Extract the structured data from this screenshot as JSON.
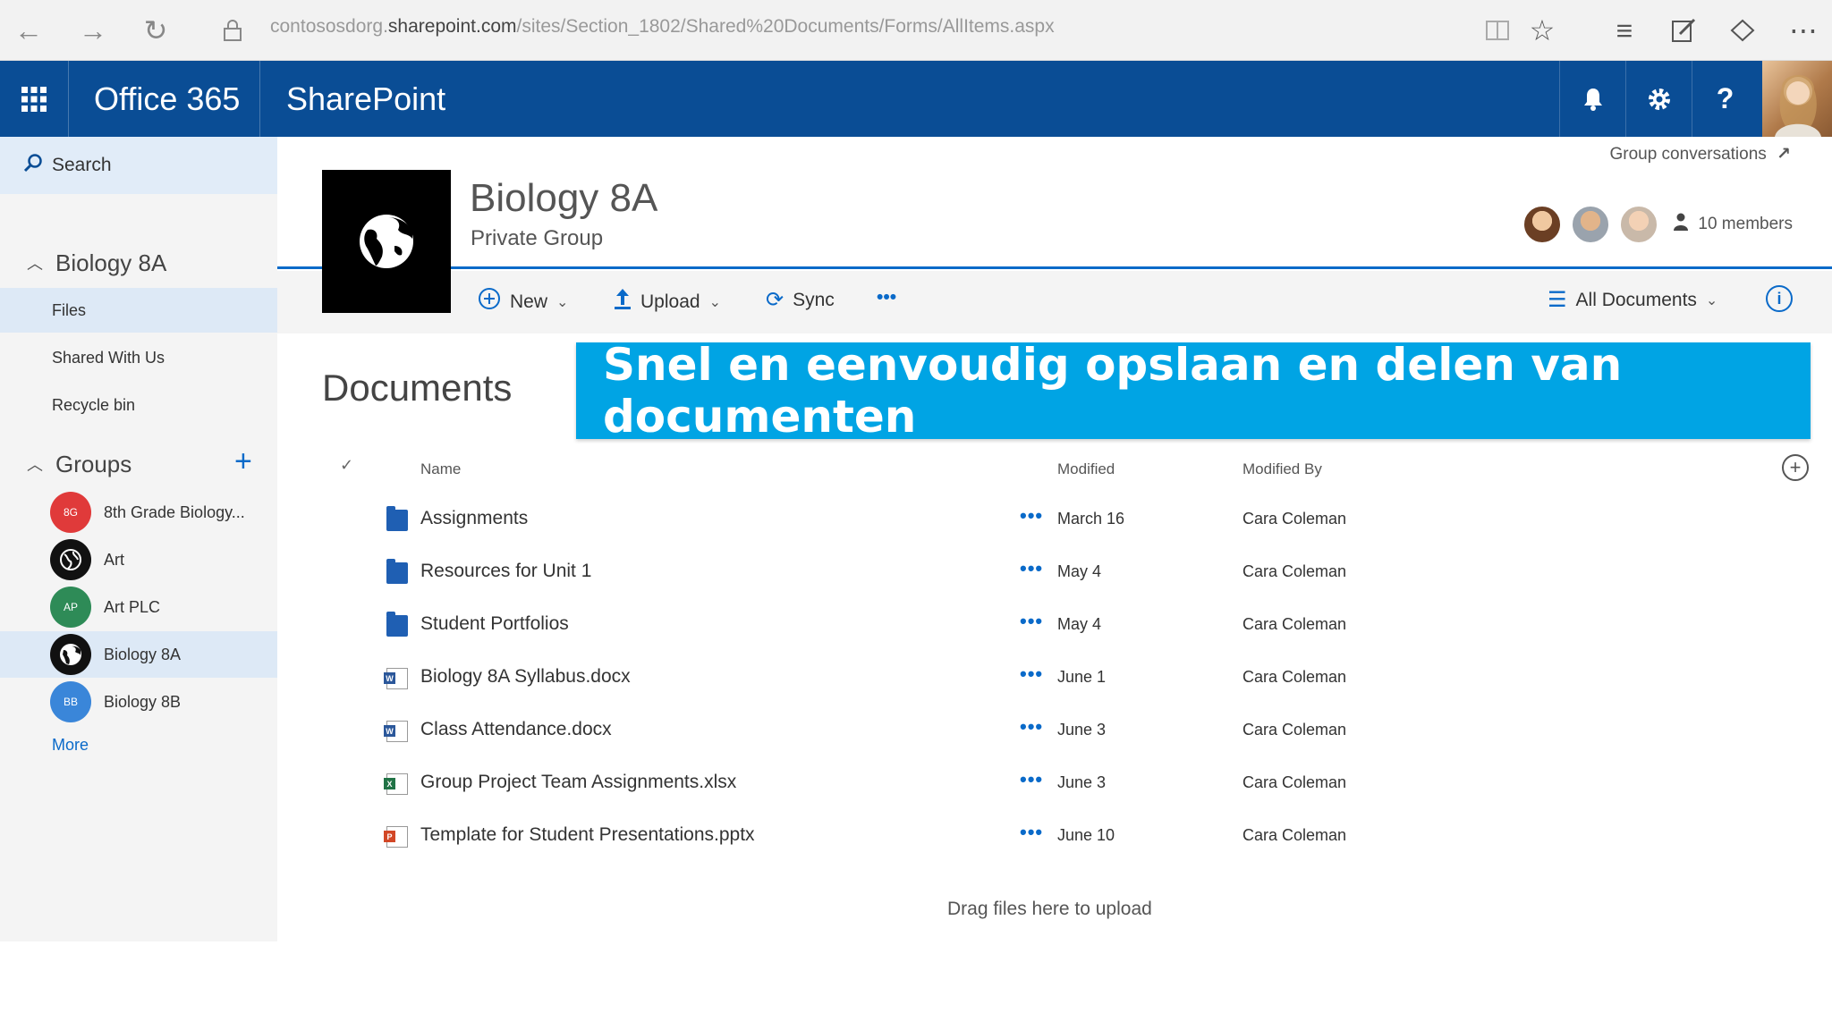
{
  "browser": {
    "url_prefix": "contososdorg.",
    "url_host": "sharepoint.com",
    "url_path": "/sites/Section_1802/Shared%20Documents/Forms/AllItems.aspx"
  },
  "suite": {
    "brand": "Office 365",
    "app": "SharePoint"
  },
  "nav": {
    "search_label": "Search",
    "site_head": "Biology 8A",
    "items": [
      {
        "label": "Files",
        "selected": true
      },
      {
        "label": "Shared With Us",
        "selected": false
      },
      {
        "label": "Recycle bin",
        "selected": false
      }
    ],
    "groups_head": "Groups",
    "groups": [
      {
        "initials": "8G",
        "label": "8th Grade Biology...",
        "color": "#e03a3a"
      },
      {
        "initials": "",
        "label": "Art",
        "color": "#111111"
      },
      {
        "initials": "AP",
        "label": "Art PLC",
        "color": "#2e8b57"
      },
      {
        "initials": "",
        "label": "Biology 8A",
        "color": "#111111"
      },
      {
        "initials": "BB",
        "label": "Biology 8B",
        "color": "#3a86d9"
      }
    ],
    "more_label": "More"
  },
  "site": {
    "title": "Biology 8A",
    "subtitle": "Private Group",
    "group_conversations": "Group conversations",
    "members": "10 members"
  },
  "commands": {
    "new": "New",
    "upload": "Upload",
    "sync": "Sync",
    "more": "•••",
    "view": "All Documents"
  },
  "library": {
    "title": "Documents",
    "banner": "Snel en eenvoudig opslaan en delen van documenten",
    "columns": {
      "name": "Name",
      "modified": "Modified",
      "modified_by": "Modified By"
    },
    "rows": [
      {
        "type": "folder",
        "name": "Assignments",
        "modified": "March 16",
        "by": "Cara Coleman"
      },
      {
        "type": "folder",
        "name": "Resources for Unit 1",
        "modified": "May 4",
        "by": "Cara Coleman"
      },
      {
        "type": "folder",
        "name": "Student Portfolios",
        "modified": "May 4",
        "by": "Cara Coleman"
      },
      {
        "type": "word",
        "name": "Biology 8A Syllabus.docx",
        "modified": "June 1",
        "by": "Cara Coleman"
      },
      {
        "type": "word",
        "name": "Class Attendance.docx",
        "modified": "June 3",
        "by": "Cara Coleman"
      },
      {
        "type": "excel",
        "name": "Group Project Team Assignments.xlsx",
        "modified": "June 3",
        "by": "Cara Coleman"
      },
      {
        "type": "powerpoint",
        "name": "Template for Student Presentations.pptx",
        "modified": "June 10",
        "by": "Cara Coleman"
      }
    ],
    "drop_hint": "Drag files here to upload"
  },
  "colors": {
    "suite_bar": "#0a4d95",
    "accent": "#0a6ac9",
    "banner": "#00a4e4"
  }
}
